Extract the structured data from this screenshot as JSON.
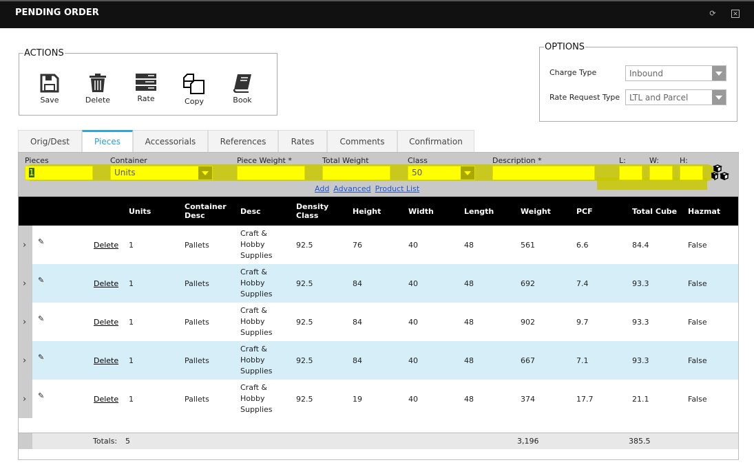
{
  "header": {
    "title": "PENDING ORDER",
    "refresh_icon": "refresh-icon",
    "close_icon": "close-icon"
  },
  "actions": {
    "legend": "ACTIONS",
    "buttons": [
      {
        "label": "Save",
        "icon": "save-icon"
      },
      {
        "label": "Delete",
        "icon": "trash-icon"
      },
      {
        "label": "Rate",
        "icon": "rate-icon"
      },
      {
        "label": "Copy",
        "icon": "copy-icon"
      },
      {
        "label": "Book",
        "icon": "book-icon"
      }
    ]
  },
  "options": {
    "legend": "OPTIONS",
    "charge_type_label": "Charge Type",
    "charge_type": "Inbound",
    "rate_request_label": "Rate Request Type",
    "rate_request": "LTL and Parcel"
  },
  "tabs": [
    "Orig/Dest",
    "Pieces",
    "Accessorials",
    "References",
    "Rates",
    "Comments",
    "Confirmation"
  ],
  "active_tab": "Pieces",
  "form": {
    "pieces_label": "Pieces",
    "pieces": "1",
    "container_label": "Container",
    "container": "Units",
    "piece_weight_label": "Piece Weight *",
    "total_weight_label": "Total Weight",
    "class_label": "Class",
    "class": "50",
    "description_label": "Description *",
    "l_label": "L:",
    "w_label": "W:",
    "h_label": "H:",
    "links": [
      "Add",
      "Advanced",
      "Product List"
    ]
  },
  "table": {
    "headers": [
      "",
      "",
      "",
      "Units",
      "Container Desc",
      "Desc",
      "Density Class",
      "Height",
      "Width",
      "Length",
      "Weight",
      "PCF",
      "Total Cube",
      "Hazmat"
    ],
    "delete_label": "Delete",
    "rows": [
      [
        "1",
        "Pallets",
        "Craft & Hobby Supplies",
        "92.5",
        "76",
        "40",
        "48",
        "561",
        "6.6",
        "84.4",
        "False"
      ],
      [
        "1",
        "Pallets",
        "Craft & Hobby Supplies",
        "92.5",
        "84",
        "40",
        "48",
        "692",
        "7.4",
        "93.3",
        "False"
      ],
      [
        "1",
        "Pallets",
        "Craft & Hobby Supplies",
        "92.5",
        "84",
        "40",
        "48",
        "902",
        "9.7",
        "93.3",
        "False"
      ],
      [
        "1",
        "Pallets",
        "Craft & Hobby Supplies",
        "92.5",
        "84",
        "40",
        "48",
        "667",
        "7.1",
        "93.3",
        "False"
      ],
      [
        "1",
        "Pallets",
        "Craft & Hobby Supplies",
        "92.5",
        "19",
        "40",
        "48",
        "374",
        "17.7",
        "21.1",
        "False"
      ]
    ],
    "totals": {
      "label": "Totals:",
      "units": "5",
      "weight": "3,196",
      "total_cube": "385.5"
    }
  },
  "colors": {
    "highlight": "#ffff00",
    "tab_accent": "#29a8e0",
    "alt_row": "#d5eef8"
  }
}
